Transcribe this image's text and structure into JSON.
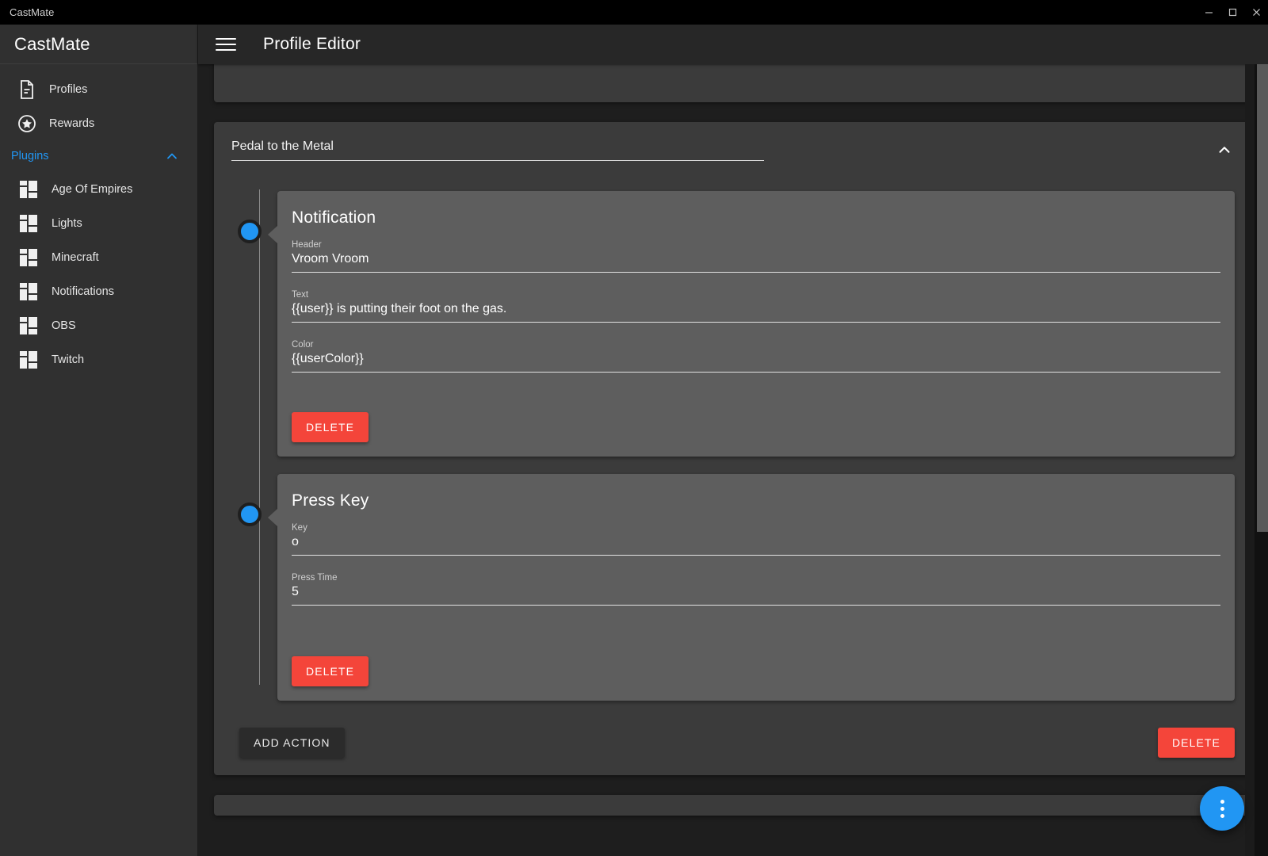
{
  "window": {
    "title": "CastMate",
    "controls": [
      {
        "name": "minimize",
        "glyph": "minimize-icon"
      },
      {
        "name": "maximize",
        "glyph": "maximize-icon"
      },
      {
        "name": "close",
        "glyph": "close-icon"
      }
    ]
  },
  "sidebar": {
    "brand": "CastMate",
    "items": [
      {
        "label": "Profiles",
        "icon": "document-icon"
      },
      {
        "label": "Rewards",
        "icon": "star-circle-icon"
      }
    ],
    "group": {
      "label": "Plugins",
      "expanded": true,
      "chevron": "chevron-up-icon",
      "items": [
        {
          "label": "Age Of Empires",
          "icon": "dashboard-grid-icon"
        },
        {
          "label": "Lights",
          "icon": "dashboard-grid-icon"
        },
        {
          "label": "Minecraft",
          "icon": "dashboard-grid-icon"
        },
        {
          "label": "Notifications",
          "icon": "dashboard-grid-icon"
        },
        {
          "label": "OBS",
          "icon": "dashboard-grid-icon"
        },
        {
          "label": "Twitch",
          "icon": "dashboard-grid-icon"
        }
      ]
    }
  },
  "appbar": {
    "menu_icon": "hamburger-icon",
    "title": "Profile Editor"
  },
  "profile": {
    "name": "Pedal to the Metal",
    "collapse_icon": "chevron-up-icon",
    "actions": [
      {
        "title": "Notification",
        "fields": [
          {
            "label": "Header",
            "value": "Vroom Vroom"
          },
          {
            "label": "Text",
            "value": "{{user}} is putting their foot on the gas."
          },
          {
            "label": "Color",
            "value": "{{userColor}}"
          }
        ],
        "delete_label": "DELETE"
      },
      {
        "title": "Press Key",
        "fields": [
          {
            "label": "Key",
            "value": "o"
          },
          {
            "label": "Press Time",
            "value": "5"
          }
        ],
        "delete_label": "DELETE"
      }
    ],
    "add_action_label": "ADD ACTION",
    "delete_label": "DELETE"
  },
  "fab": {
    "icon": "more-vertical-icon"
  },
  "colors": {
    "accent": "#2196f3",
    "danger": "#f4453a",
    "sidebar_bg": "#303030",
    "card_bg": "#3b3b3b",
    "action_card_bg": "#5e5e5e",
    "app_bg": "#1e1e1e",
    "appbar_bg": "#272727"
  }
}
